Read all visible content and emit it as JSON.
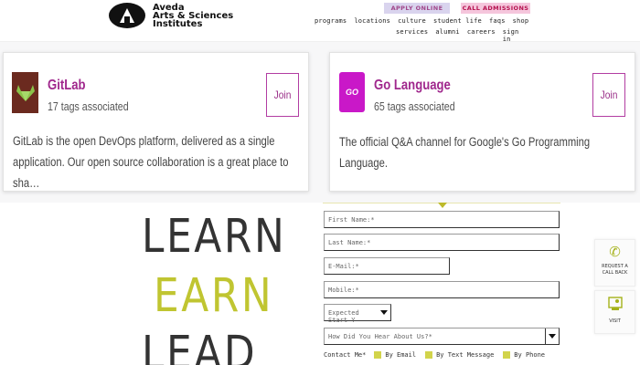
{
  "header": {
    "logo_line1": "Aveda",
    "logo_line2": "Arts & Sciences",
    "logo_line3": "Institutes",
    "apply_label": "APPLY ONLINE",
    "call_label": "CALL ADMISSIONS",
    "nav_row1": [
      "programs",
      "locations",
      "culture",
      "student life",
      "faqs",
      "shop"
    ],
    "nav_row2": [
      "services",
      "alumni",
      "careers",
      "sign in"
    ]
  },
  "cards": [
    {
      "title": "GitLab",
      "tags": "17 tags associated",
      "description": "GitLab is the open DevOps platform, delivered as a single application. Our open source collaboration is a great place to sha…",
      "join_label": "Join",
      "icon": "gitlab-icon"
    },
    {
      "title": "Go Language",
      "tags": "65 tags associated",
      "description": "The official Q&A channel for Google's Go Programming Language.",
      "join_label": "Join",
      "icon": "go-icon",
      "logo_text": "GO"
    }
  ],
  "slogan": {
    "line1": "LEARN",
    "line2": "EARN",
    "line3": "LEAD"
  },
  "form": {
    "first_name": "First Name:*",
    "last_name": "Last Name:*",
    "email": "E-Mail:*",
    "mobile": "Mobile:*",
    "start": "Expected Start Y",
    "hear": "How Did You Hear About Us?*",
    "contact_label": "Contact Me*",
    "contact_options": [
      "By Email",
      "By Text Message",
      "By Phone"
    ]
  },
  "side": {
    "call_label": "REQUEST A CALL BACK",
    "visit_label": "VISIT",
    "call_icon": "phone-icon",
    "visit_icon": "visit-icon"
  },
  "colors": {
    "brand_purple": "#a0288d",
    "accent_yellow": "#c0c531",
    "apply_bg": "#d9d4ee",
    "call_bg": "#f5c6dc"
  }
}
